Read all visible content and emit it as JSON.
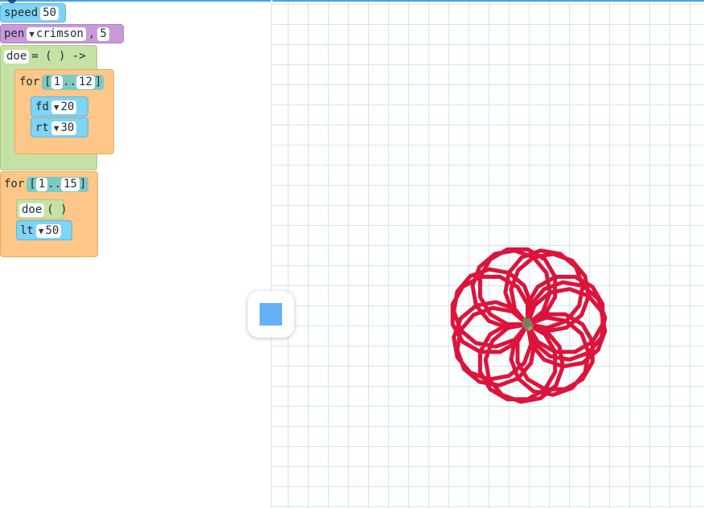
{
  "code": {
    "speed": {
      "keyword": "speed",
      "value": "50"
    },
    "pen": {
      "keyword": "pen",
      "color_option": "crimson",
      "comma": ",",
      "width": "5"
    },
    "def": {
      "name": "doe",
      "rest": "= ( ) ->"
    },
    "inner_for": {
      "keyword": "for",
      "open": "[",
      "start": "1",
      "dots": "..",
      "end": "12",
      "close": "]"
    },
    "fd": {
      "keyword": "fd",
      "value": "20"
    },
    "rt": {
      "keyword": "rt",
      "value": "30"
    },
    "outer_for": {
      "keyword": "for",
      "open": "[",
      "start": "1",
      "dots": "..",
      "end": "15",
      "close": "]"
    },
    "call": {
      "name": "doe",
      "parens": "( )"
    },
    "lt": {
      "keyword": "lt",
      "value": "50"
    }
  },
  "icons": {
    "dropdown": "▼"
  },
  "colors": {
    "pen": "#dc143c",
    "motion_block": "#7fd3f5",
    "pen_block": "#c99ad9",
    "function_block": "#c6e1a4",
    "loop_block": "#fec787",
    "grid_line": "#cfe9e6",
    "accent": "#42a5f5"
  },
  "drawing": {
    "speed": 50,
    "pen_width": 5,
    "outer_repeats": 15,
    "inner_repeats": 12,
    "forward": 20,
    "right_turn_deg": 30,
    "left_turn_deg": 50
  }
}
